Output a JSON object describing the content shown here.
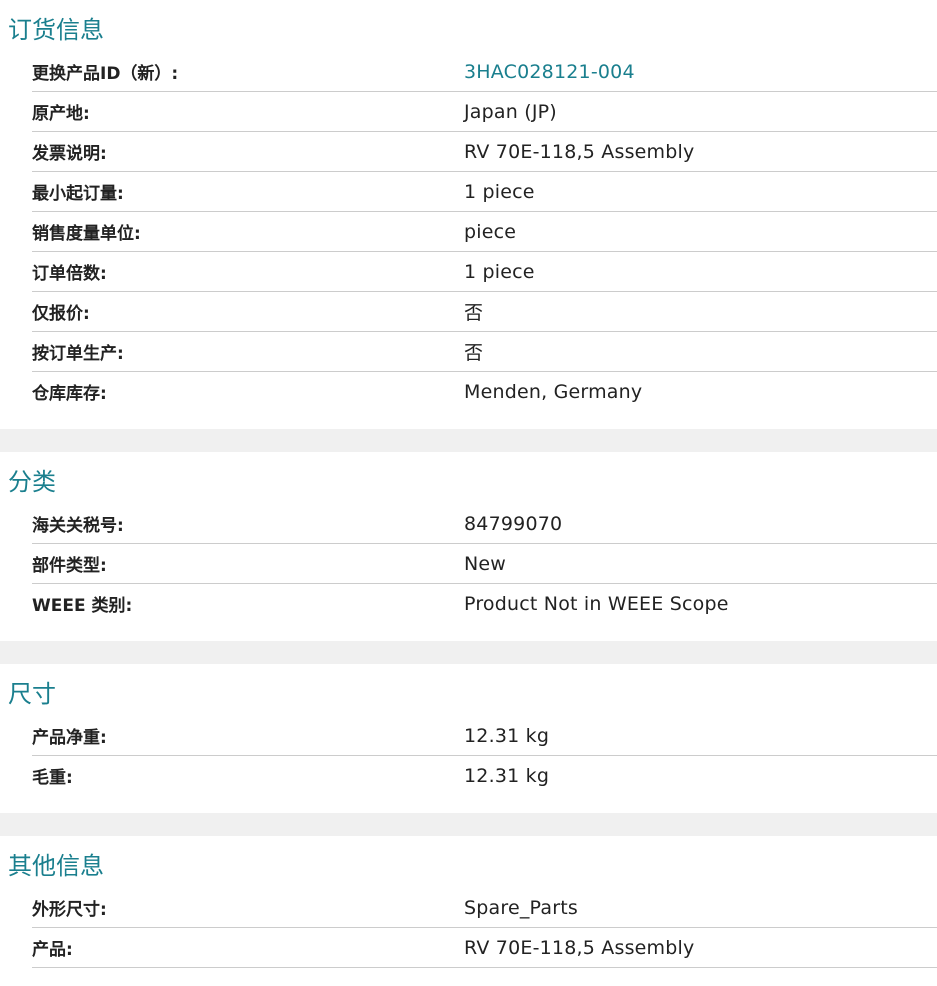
{
  "sections": [
    {
      "title": "订货信息",
      "rows": [
        {
          "label": "更换产品ID（新）:",
          "value": "3HAC028121-004"
        },
        {
          "label": "原产地:",
          "value": "Japan (JP)"
        },
        {
          "label": "发票说明:",
          "value": "RV 70E-118,5 Assembly"
        },
        {
          "label": "最小起订量:",
          "value": "1 piece"
        },
        {
          "label": "销售度量单位:",
          "value": "piece"
        },
        {
          "label": "订单倍数:",
          "value": "1 piece"
        },
        {
          "label": "仅报价:",
          "value": "否"
        },
        {
          "label": "按订单生产:",
          "value": "否"
        },
        {
          "label": "仓库库存:",
          "value": "Menden, Germany"
        }
      ]
    },
    {
      "title": "分类",
      "rows": [
        {
          "label": "海关关税号:",
          "value": "84799070"
        },
        {
          "label": "部件类型:",
          "value": "New"
        },
        {
          "label": "WEEE 类别:",
          "value": "Product Not in WEEE Scope"
        }
      ]
    },
    {
      "title": "尺寸",
      "rows": [
        {
          "label": "产品净重:",
          "value": "12.31 kg"
        },
        {
          "label": "毛重:",
          "value": "12.31 kg"
        }
      ]
    },
    {
      "title": "其他信息",
      "rows": [
        {
          "label": "外形尺寸:",
          "value": "Spare_Parts"
        },
        {
          "label": "产品:",
          "value": "RV 70E-118,5 Assembly"
        }
      ]
    }
  ],
  "colors": {
    "accent": "#1a7f8e",
    "divider": "#cccccc",
    "band": "#f0f0f0"
  }
}
